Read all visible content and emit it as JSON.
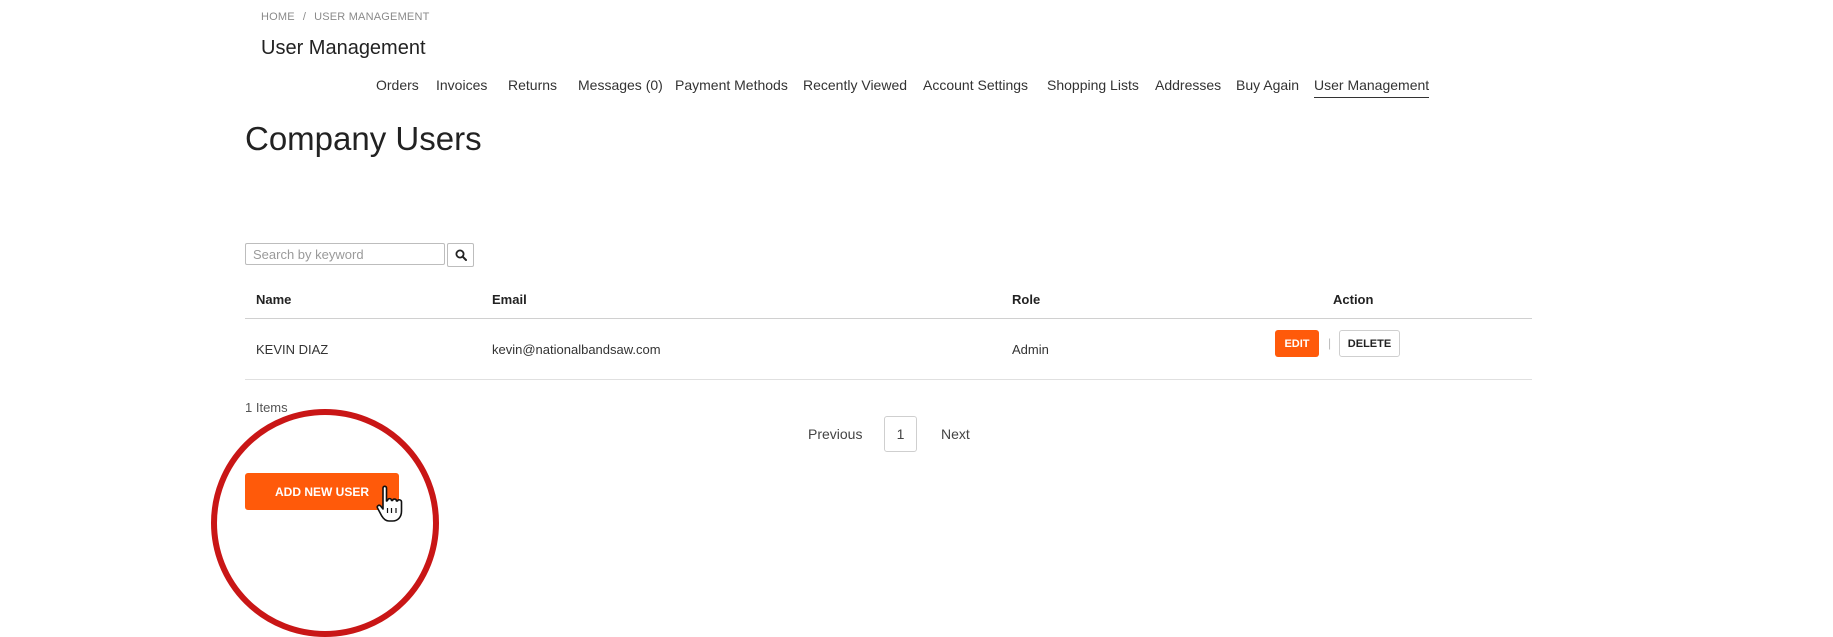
{
  "breadcrumb": {
    "home": "HOME",
    "separator": "/",
    "current": "USER MANAGEMENT"
  },
  "page_title": "User Management",
  "tabs": [
    {
      "label": "Orders",
      "active": false
    },
    {
      "label": "Invoices",
      "active": false
    },
    {
      "label": "Returns",
      "active": false
    },
    {
      "label": "Messages (0)",
      "active": false
    },
    {
      "label": "Payment Methods",
      "active": false
    },
    {
      "label": "Recently Viewed",
      "active": false
    },
    {
      "label": "Account Settings",
      "active": false
    },
    {
      "label": "Shopping Lists",
      "active": false
    },
    {
      "label": "Addresses",
      "active": false
    },
    {
      "label": "Buy Again",
      "active": false
    },
    {
      "label": "User Management",
      "active": true
    }
  ],
  "heading": "Company Users",
  "search": {
    "placeholder": "Search by keyword",
    "value": "",
    "icon": "search-icon"
  },
  "table": {
    "columns": [
      "Name",
      "Email",
      "Role",
      "Action"
    ],
    "rows": [
      {
        "name": "KEVIN DIAZ",
        "email": "kevin@nationalbandsaw.com",
        "role": "Admin",
        "edit_label": "EDIT",
        "separator": "|",
        "delete_label": "DELETE"
      }
    ]
  },
  "items_count": "1 Items",
  "pagination": {
    "previous": "Previous",
    "current_page": "1",
    "next": "Next"
  },
  "add_button_label": "ADD NEW USER",
  "colors": {
    "accent": "#ff5a0a",
    "highlight_circle": "#c91616",
    "text": "#333333"
  }
}
